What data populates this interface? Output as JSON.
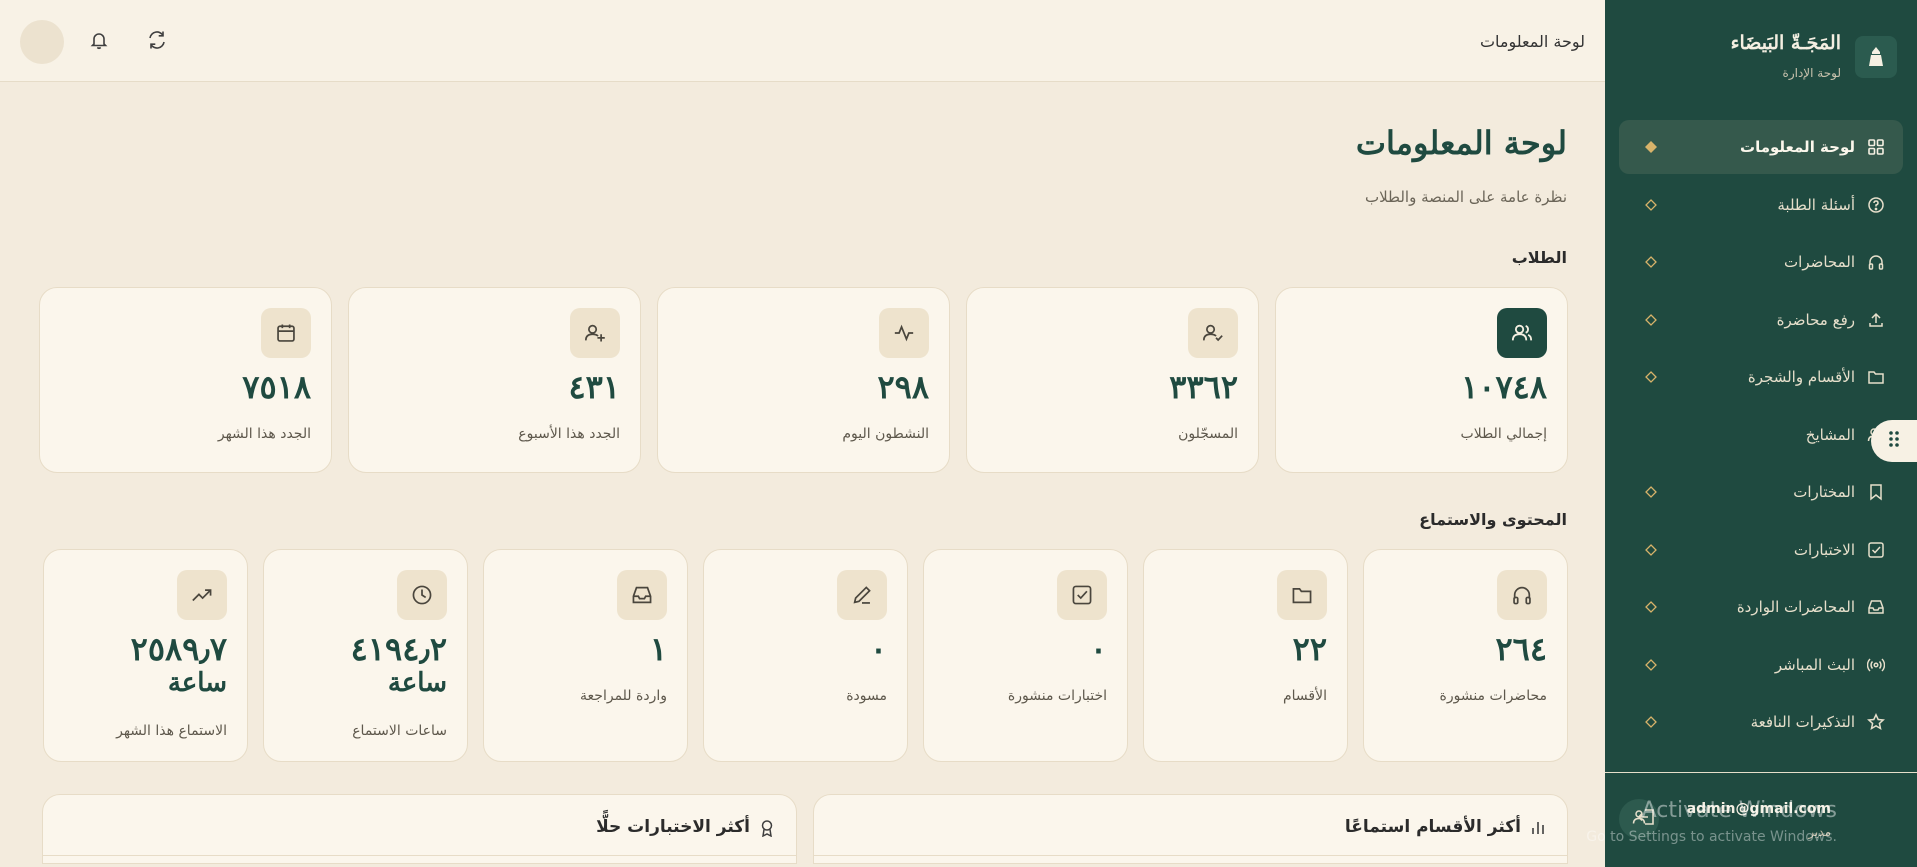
{
  "brand": {
    "title": "المَجَـةّ البَيضَاء",
    "subtitle": "لوحة الإدارة"
  },
  "topbar": {
    "title": "لوحة المعلومات"
  },
  "page": {
    "title": "لوحة المعلومات",
    "subtitle": "نظرة عامة على المنصة والطلاب"
  },
  "sidebar": {
    "items": [
      {
        "label": "لوحة المعلومات",
        "icon": "grid-icon",
        "active": true
      },
      {
        "label": "أسئلة الطلبة",
        "icon": "question-circle-icon"
      },
      {
        "label": "المحاضرات",
        "icon": "headphones-icon"
      },
      {
        "label": "رفع محاضرة",
        "icon": "upload-icon"
      },
      {
        "label": "الأقسام والشجرة",
        "icon": "folder-icon"
      },
      {
        "label": "المشايخ",
        "icon": "users-icon"
      },
      {
        "label": "المختارات",
        "icon": "bookmark-icon"
      },
      {
        "label": "الاختبارات",
        "icon": "checkbox-icon"
      },
      {
        "label": "المحاضرات الواردة",
        "icon": "inbox-icon"
      },
      {
        "label": "البث المباشر",
        "icon": "broadcast-icon"
      },
      {
        "label": "التذكيرات النافعة",
        "icon": "star-icon"
      }
    ]
  },
  "user": {
    "email": "admin@gmail.com",
    "role": "مدير"
  },
  "watermark": {
    "line1": "Activate Windows",
    "line2": "Go to Settings to activate Windows."
  },
  "sections": {
    "students": "الطلاب",
    "content": "المحتوى والاستماع"
  },
  "student_stats": [
    {
      "value": "١٠٧٤٨",
      "label": "إجمالي الطلاب",
      "icon": "users-icon"
    },
    {
      "value": "٣٣٦٢",
      "label": "المسجّلون",
      "icon": "user-check-icon"
    },
    {
      "value": "٢٩٨",
      "label": "النشطون اليوم",
      "icon": "activity-icon"
    },
    {
      "value": "٤٣١",
      "label": "الجدد هذا الأسبوع",
      "icon": "user-plus-icon"
    },
    {
      "value": "٧٥١٨",
      "label": "الجدد هذا الشهر",
      "icon": "calendar-icon"
    }
  ],
  "content_stats": [
    {
      "value": "٢٦٤",
      "label": "محاضرات منشورة",
      "icon": "headphones-icon"
    },
    {
      "value": "٢٢",
      "label": "الأقسام",
      "icon": "folder-icon"
    },
    {
      "value": "٠",
      "label": "اختبارات منشورة",
      "icon": "checkbox-icon"
    },
    {
      "value": "٠",
      "label": "مسودة",
      "icon": "pencil-icon"
    },
    {
      "value": "١",
      "label": "واردة للمراجعة",
      "icon": "inbox-icon"
    },
    {
      "value": "٤١٩٤٫٢",
      "unit": "ساعة",
      "label": "ساعات الاستماع",
      "icon": "clock-icon"
    },
    {
      "value": "٢٥٨٩٫٧",
      "unit": "ساعة",
      "label": "الاستماع هذا الشهر",
      "icon": "trending-up-icon"
    }
  ],
  "panels": {
    "top_sections": "أكثر الأقسام استماعًا",
    "top_quizzes": "أكثر الاختبارات حلًّا"
  },
  "colors": {
    "primary": "#1f4a40",
    "background": "#f3ebdd",
    "card": "#fbf6ec",
    "accent": "#d8b36a"
  }
}
